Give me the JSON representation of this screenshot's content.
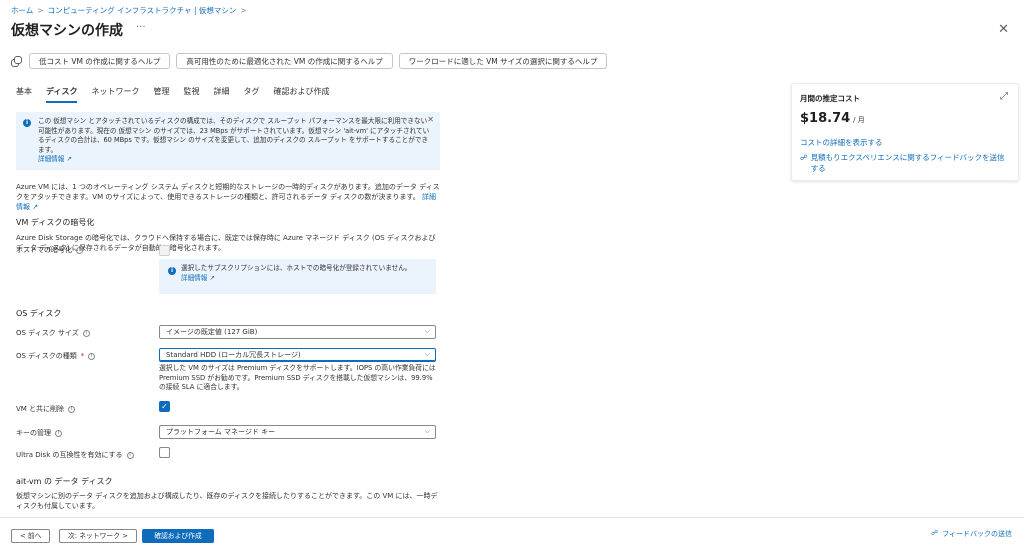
{
  "breadcrumb": {
    "items": [
      "ホーム",
      "コンピューティング インフラストラクチャ | 仮想マシン"
    ],
    "separator": ">"
  },
  "page": {
    "title": "仮想マシンの作成",
    "more": "···",
    "close": "✕"
  },
  "help_buttons": [
    "低コスト VM の作成に関するヘルプ",
    "高可用性のために最適化された VM の作成に関するヘルプ",
    "ワークロードに適した VM サイズの選択に関するヘルプ"
  ],
  "tabs": [
    {
      "label": "基本",
      "active": false
    },
    {
      "label": "ディスク",
      "active": true
    },
    {
      "label": "ネットワーク",
      "active": false
    },
    {
      "label": "管理",
      "active": false
    },
    {
      "label": "監視",
      "active": false
    },
    {
      "label": "詳細",
      "active": false
    },
    {
      "label": "タグ",
      "active": false
    },
    {
      "label": "確認および作成",
      "active": false
    }
  ],
  "info_banner": {
    "text": "この 仮想マシン とアタッチされているディスクの構成では、そのディスクで スループット パフォーマンスを最大限に利用できない可能性があります。現在の 仮想マシン のサイズでは、23 MBps がサポートされています。仮想マシン 'ait-vm' にアタッチされているディスクの合計は、60 MBps です。仮想マシン のサイズを変更して、追加のディスクの スループット をサポートすることができます。",
    "link": "詳細情報 ↗",
    "close": "✕"
  },
  "intro": {
    "text": "Azure VM には、1 つのオペレーティング システム ディスクと短期的なストレージの一時的ディスクがあります。追加のデータ ディスクをアタッチできます。VM のサイズによって、使用できるストレージの種類と、許可されるデータ ディスクの数が決まります。",
    "link": "詳細情報 ↗"
  },
  "encryption": {
    "heading": "VM ディスクの暗号化",
    "text": "Azure Disk Storage の暗号化では、クラウドへ保持する場合に、既定では保存時に Azure マネージド ディスク (OS ディスクおよびデータ ディスク) に保存されるデータが自動的に暗号化されます。",
    "host_label": "ホストでの暗号化",
    "host_info": "選択したサブスクリプションには、ホストでの暗号化が登録されていません。",
    "host_info_link": "詳細情報 ↗"
  },
  "os_disk": {
    "heading": "OS ディスク",
    "size_label": "OS ディスク サイズ",
    "size_value": "イメージの既定値 (127 GiB)",
    "type_label": "OS ディスクの種類",
    "required_mark": "*",
    "type_value": "Standard HDD (ローカル冗長ストレージ)",
    "type_help": "選択した VM のサイズは Premium ディスクをサポートします。IOPS の高い作業負荷には Premium SSD がお勧めです。Premium SSD ディスクを搭載した仮想マシンは、99.9% の接続 SLA に適合します。",
    "delete_label": "VM と共に削除",
    "key_label": "キーの管理",
    "key_value": "プラットフォーム マネージド キー",
    "ultra_label": "Ultra Disk の互換性を有効にする"
  },
  "data_disks": {
    "heading": "ait-vm の データ ディスク",
    "text": "仮想マシンに別のデータ ディスクを追加および構成したり、既存のディスクを接続したりすることができます。この VM には、一時ディスクも付属しています。"
  },
  "cost": {
    "title": "月間の推定コスト",
    "amount": "$18.74",
    "per": "/ 月",
    "details_link": "コストの詳細を表示する",
    "feedback_link": "見積もりエクスペリエンスに関するフィードバックを送信する",
    "expand": "⤢"
  },
  "footer": {
    "prev": "< 前へ",
    "next": "次: ネットワーク >",
    "review": "確認および作成",
    "feedback": "フィードバックの送信"
  },
  "colors": {
    "accent": "#0f6cbd",
    "info_bg": "#ebf3fc"
  }
}
